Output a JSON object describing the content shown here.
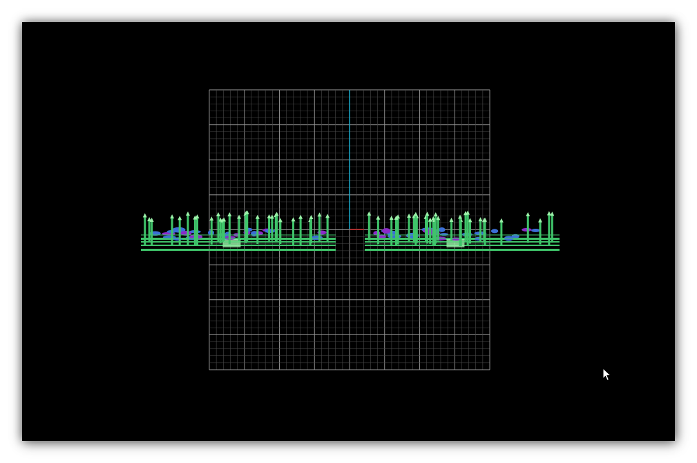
{
  "viewer": {
    "background_color": "#000000",
    "grid_color": "#9a9a9a",
    "grid_minor_color": "#4a4a4a",
    "axis_y_color": "#1aa8c8",
    "axis_x_color": "#c02020",
    "model_color": "#3fc46a",
    "model_highlight_color": "#9af0a8",
    "model_secondary_color": "#3b6fd6",
    "model_tertiary_color": "#8a2bc8",
    "grid_divisions": 40,
    "grid_major_every": 5
  },
  "cursor": {
    "icon": "arrow-cursor-icon"
  }
}
